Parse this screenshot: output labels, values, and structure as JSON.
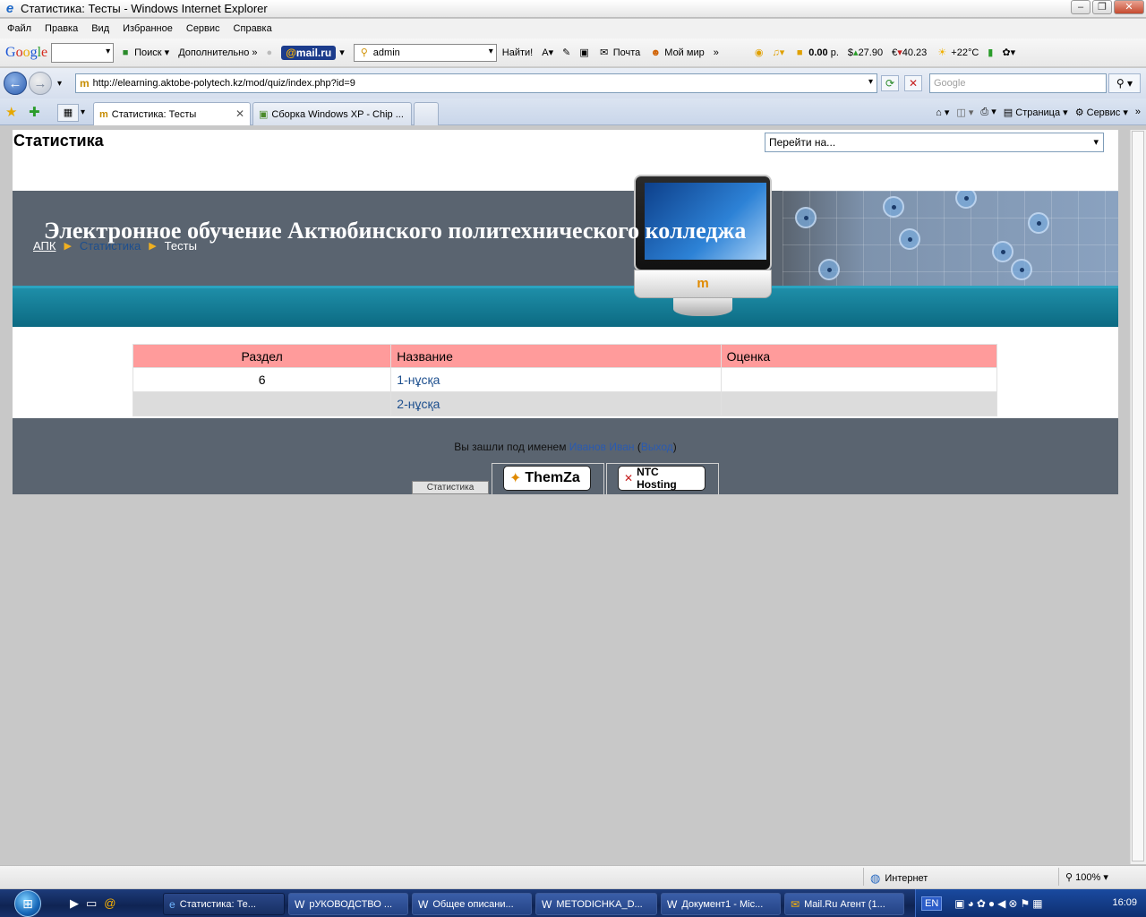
{
  "window": {
    "title": "Статистика: Тесты - Windows Internet Explorer"
  },
  "menu": [
    "Файл",
    "Правка",
    "Вид",
    "Избранное",
    "Сервис",
    "Справка"
  ],
  "toolbar": {
    "google_logo": [
      "G",
      "o",
      "o",
      "g",
      "l",
      "e"
    ],
    "search_label": "Поиск",
    "more_label": "Дополнительно",
    "mailru_logo_at": "@",
    "mailru_logo_text": "mail.ru",
    "mail_user": "admin",
    "find_label": "Найти!",
    "mail_label": "Почта",
    "myworld_label": "Мой мир",
    "balance": "0.00",
    "balance_unit": "р.",
    "usd": "27.90",
    "eur": "40.23",
    "weather": "+22°C"
  },
  "address": {
    "url": "http://elearning.aktobe-polytech.kz/mod/quiz/index.php?id=9",
    "search_placeholder": "Google"
  },
  "tabs": [
    {
      "label": "Статистика: Тесты",
      "active": true
    },
    {
      "label": "Сборка Windows XP - Chip ...",
      "active": false
    }
  ],
  "command_bar": {
    "page_label": "Страница",
    "service_label": "Сервис"
  },
  "page": {
    "heading": "Статистика",
    "jump_placeholder": "Перейти на...",
    "site_title": "Электронное обучение Актюбинского политехнического колледжа",
    "breadcrumb": {
      "home": "АПК",
      "middle": "Статистика",
      "current": "Тесты"
    },
    "table": {
      "headers": [
        "Раздел",
        "Название",
        "Оценка"
      ],
      "rows": [
        {
          "section": "6",
          "name": "1-нұсқа",
          "grade": ""
        },
        {
          "section": "",
          "name": "2-нұсқа",
          "grade": ""
        }
      ]
    },
    "footer": {
      "logged_prefix": "Вы зашли под именем",
      "user_name": "Иванов Иван",
      "logout": "Выход",
      "tab_label": "Статистика",
      "badge1": "ThemZa",
      "badge2": "NTC Hosting"
    }
  },
  "status": {
    "zone": "Интернет",
    "zoom": "100%"
  },
  "taskbar": {
    "items": [
      {
        "label": "Статистика: Те...",
        "active": true
      },
      {
        "label": "рУКОВОДСТВО ...",
        "active": false
      },
      {
        "label": "Общее описани...",
        "active": false
      },
      {
        "label": "METODICHKA_D...",
        "active": false
      },
      {
        "label": "Документ1 - Mic...",
        "active": false
      },
      {
        "label": "Mail.Ru Агент (1...",
        "active": false
      }
    ],
    "lang": "EN",
    "clock": "16:09"
  },
  "colors": {
    "table_header": "#ff9b9b",
    "banner": "#5a6470",
    "nav_strip": "#1e8ea8",
    "link": "#1d4f8e"
  }
}
